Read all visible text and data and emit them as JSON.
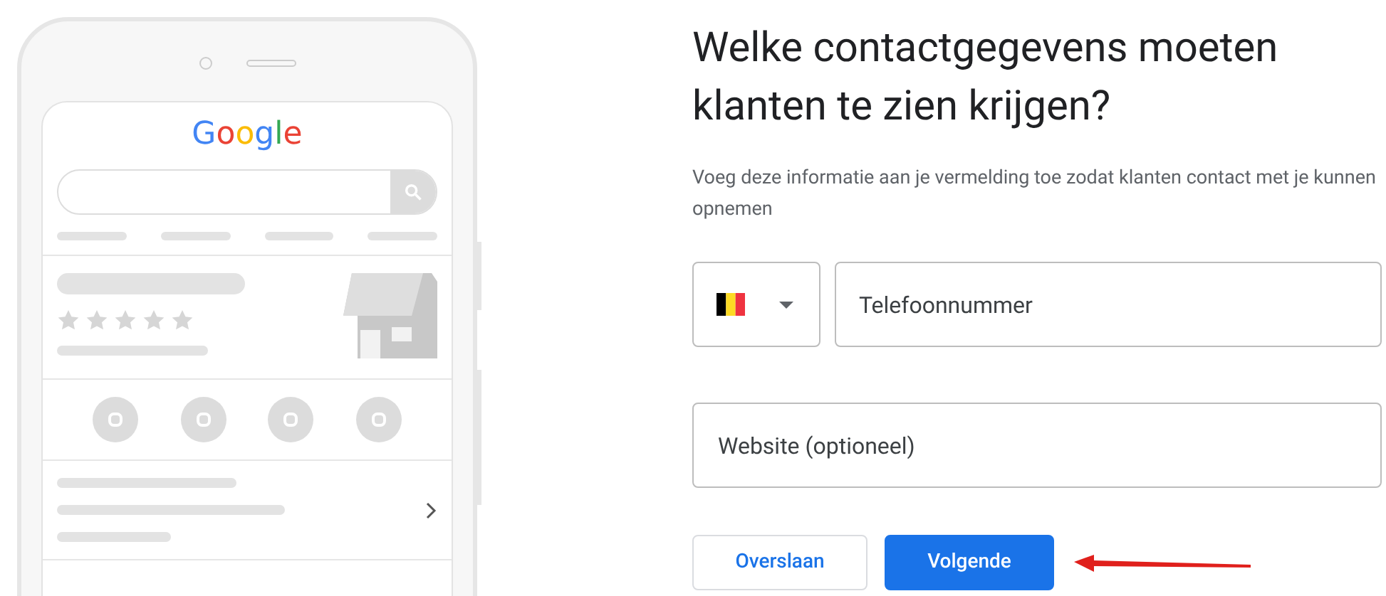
{
  "phone_illustration": {
    "logo": "Google"
  },
  "form": {
    "title": "Welke contactgegevens moeten klanten te zien krijgen?",
    "subtitle": "Voeg deze informatie aan je vermelding toe zodat klanten contact met je kunnen opnemen",
    "phone": {
      "placeholder": "Telefoonnummer"
    },
    "website": {
      "placeholder": "Website (optioneel)"
    },
    "buttons": [
      {
        "label": "Overslaan",
        "kind": "secondary"
      },
      {
        "label": "Volgende",
        "kind": "primary"
      }
    ]
  }
}
